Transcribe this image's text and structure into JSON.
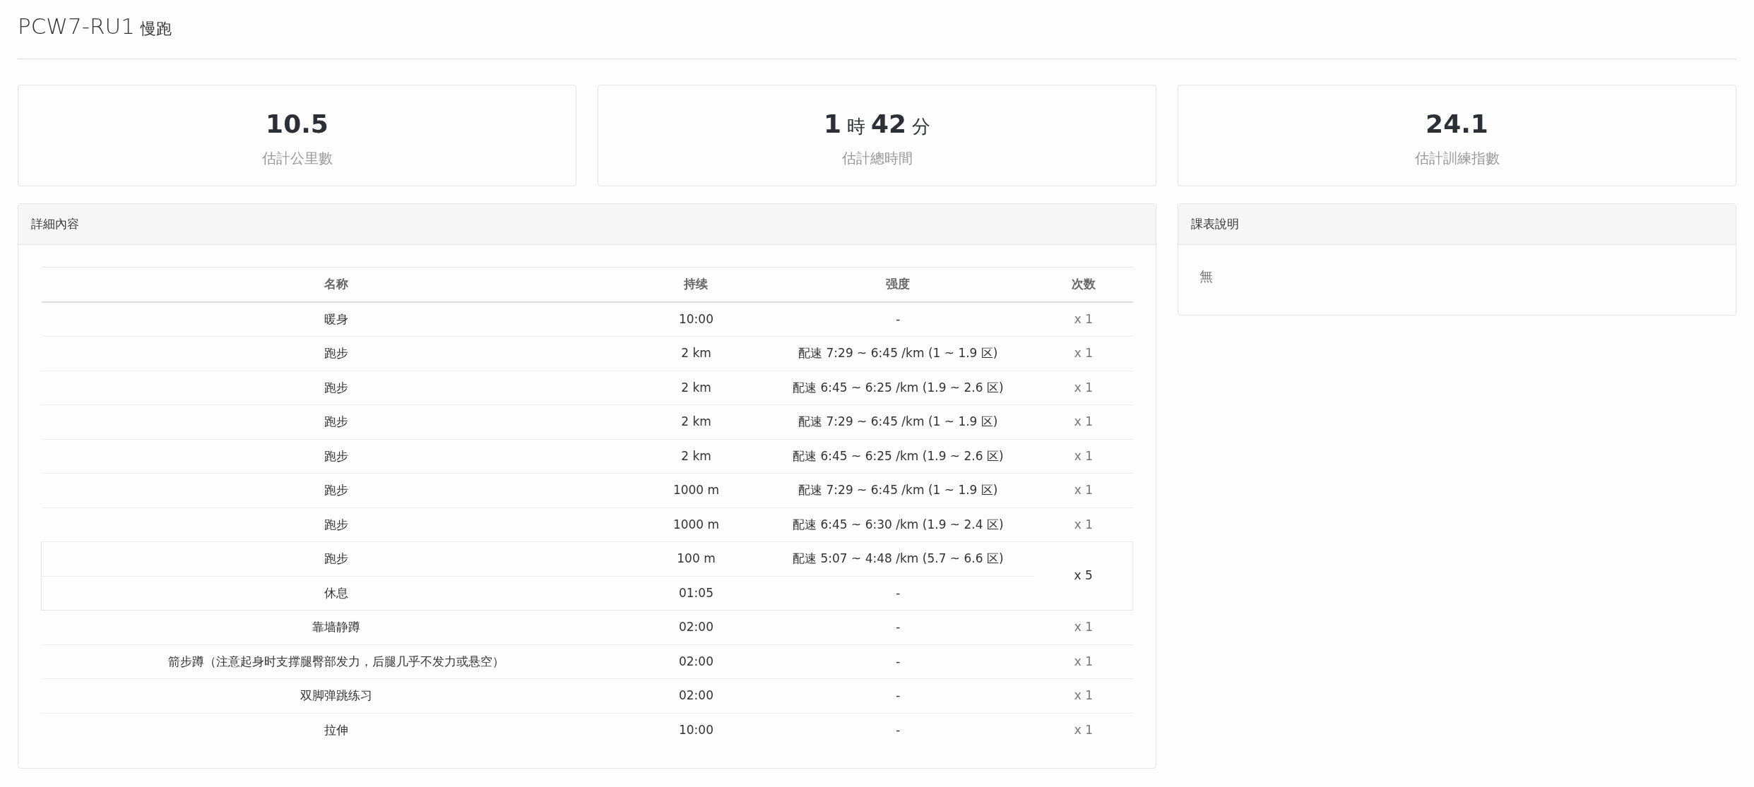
{
  "page_title": {
    "code": "PCW7-RU1",
    "name": "慢跑"
  },
  "stats": [
    {
      "value_parts": [
        {
          "text": "10.5",
          "kind": "number"
        }
      ],
      "label": "估計公里數"
    },
    {
      "value_parts": [
        {
          "text": "1",
          "kind": "number"
        },
        {
          "text": "時",
          "kind": "unit"
        },
        {
          "text": "42",
          "kind": "number"
        },
        {
          "text": "分",
          "kind": "unit"
        }
      ],
      "label": "估計總時間"
    },
    {
      "value_parts": [
        {
          "text": "24.1",
          "kind": "number"
        }
      ],
      "label": "估計訓練指數"
    }
  ],
  "details": {
    "title": "詳細內容",
    "columns": [
      "名称",
      "持续",
      "强度",
      "次数"
    ],
    "rows": [
      {
        "kind": "step",
        "name": "暖身",
        "duration": "10:00",
        "intensity": "-",
        "count": "x 1"
      },
      {
        "kind": "step",
        "name": "跑步",
        "duration": "2 km",
        "intensity": "配速 7:29 ~ 6:45 /km (1 ~ 1.9 区)",
        "count": "x 1"
      },
      {
        "kind": "step",
        "name": "跑步",
        "duration": "2 km",
        "intensity": "配速 6:45 ~ 6:25 /km (1.9 ~ 2.6 区)",
        "count": "x 1"
      },
      {
        "kind": "step",
        "name": "跑步",
        "duration": "2 km",
        "intensity": "配速 7:29 ~ 6:45 /km (1 ~ 1.9 区)",
        "count": "x 1"
      },
      {
        "kind": "step",
        "name": "跑步",
        "duration": "2 km",
        "intensity": "配速 6:45 ~ 6:25 /km (1.9 ~ 2.6 区)",
        "count": "x 1"
      },
      {
        "kind": "step",
        "name": "跑步",
        "duration": "1000 m",
        "intensity": "配速 7:29 ~ 6:45 /km (1 ~ 1.9 区)",
        "count": "x 1"
      },
      {
        "kind": "step",
        "name": "跑步",
        "duration": "1000 m",
        "intensity": "配速 6:45 ~ 6:30 /km (1.9 ~ 2.4 区)",
        "count": "x 1"
      },
      {
        "kind": "repeat",
        "count": "x 5",
        "steps": [
          {
            "name": "跑步",
            "duration": "100 m",
            "intensity": "配速 5:07 ~ 4:48 /km (5.7 ~ 6.6 区)"
          },
          {
            "name": "休息",
            "duration": "01:05",
            "intensity": "-"
          }
        ]
      },
      {
        "kind": "step",
        "name": "靠墙静蹲",
        "duration": "02:00",
        "intensity": "-",
        "count": "x 1"
      },
      {
        "kind": "step",
        "name": "箭步蹲（注意起身时支撑腿臀部发力，后腿几乎不发力或悬空）",
        "duration": "02:00",
        "intensity": "-",
        "count": "x 1"
      },
      {
        "kind": "step",
        "name": "双脚弹跳练习",
        "duration": "02:00",
        "intensity": "-",
        "count": "x 1"
      },
      {
        "kind": "step",
        "name": "拉伸",
        "duration": "10:00",
        "intensity": "-",
        "count": "x 1"
      }
    ]
  },
  "notes": {
    "title": "課表說明",
    "text": "無"
  }
}
